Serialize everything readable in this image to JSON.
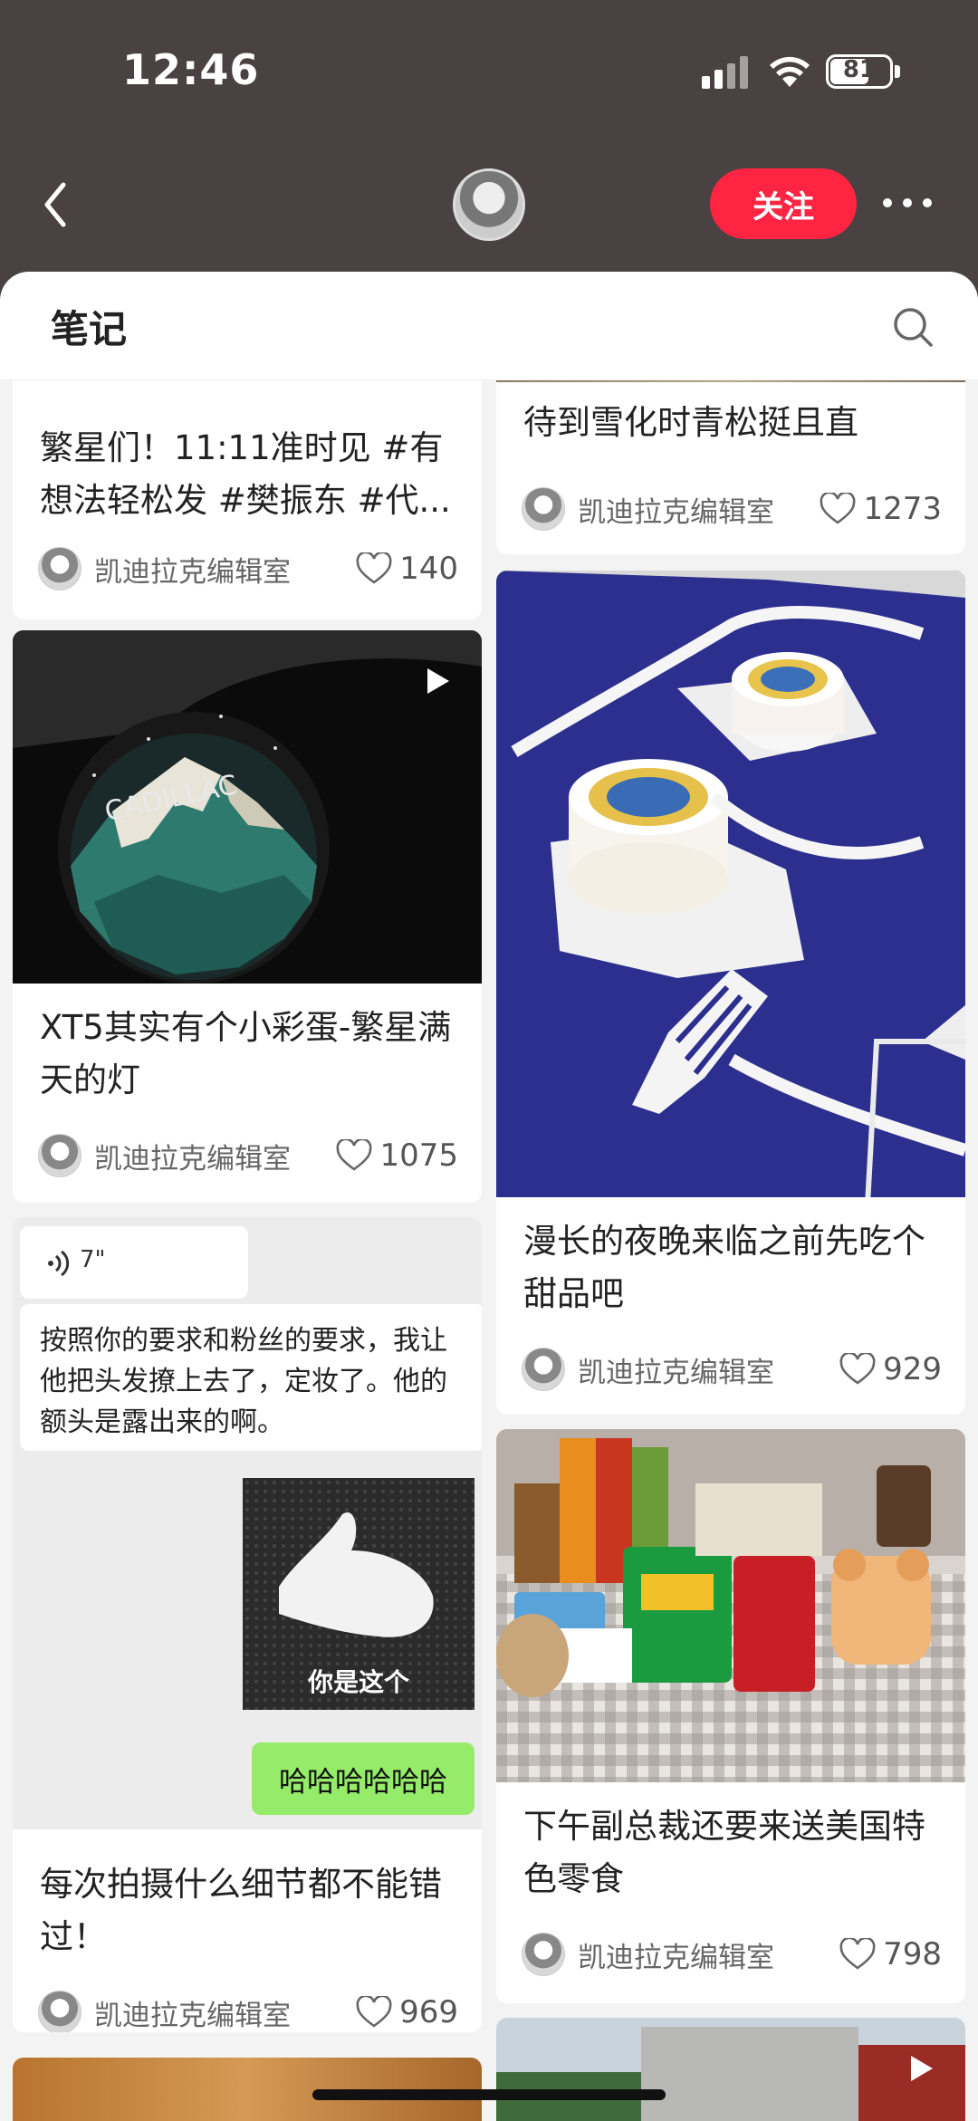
{
  "status": {
    "time": "12:46",
    "battery": "81"
  },
  "header": {
    "follow_label": "关注"
  },
  "tab": {
    "label": "笔记"
  },
  "cards": [
    {
      "title": "繁星们！11:11准时见 #有想法轻松发 #樊振东 #代...",
      "author": "凯迪拉克编辑室",
      "likes": "140"
    },
    {
      "title": "待到雪化时青松挺且直",
      "author": "凯迪拉克编辑室",
      "likes": "1273"
    },
    {
      "title": "XT5其实有个小彩蛋-繁星满天的灯",
      "author": "凯迪拉克编辑室",
      "likes": "1075",
      "image_text": "CADILLAC"
    },
    {
      "title": "漫长的夜晚来临之前先吃个甜品吧",
      "author": "凯迪拉克编辑室",
      "likes": "929"
    },
    {
      "title": "每次拍摄什么细节都不能错过！",
      "author": "凯迪拉克编辑室",
      "likes": "969"
    },
    {
      "title": "下午副总裁还要来送美国特色零食",
      "author": "凯迪拉克编辑室",
      "likes": "798"
    }
  ],
  "chat": {
    "voice_duration": "7\"",
    "message": "按照你的要求和粉丝的要求，我让他把头发撩上去了，定妆了。他的额头是露出来的啊。",
    "image_caption": "你是这个",
    "reply": "哈哈哈哈哈哈"
  },
  "colors": {
    "accent": "#ff2442",
    "header_bg": "#4a4242",
    "chat_green": "#95ec69"
  }
}
